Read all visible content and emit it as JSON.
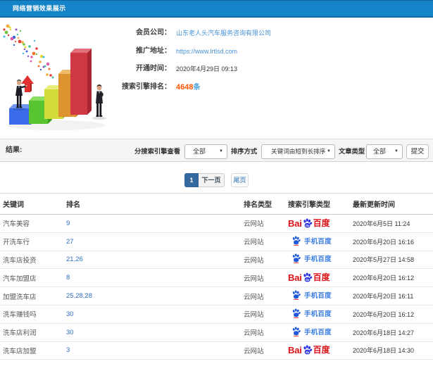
{
  "titlebar": {
    "title": "网络营销效果展示"
  },
  "info": {
    "rows": [
      {
        "label": "会员公司：",
        "value": "山东老人头汽车服务咨询有限公司",
        "style": "link"
      },
      {
        "label": "推广地址：",
        "value": "https://www.lrtlsd.com",
        "style": "link"
      },
      {
        "label": "开通时间：",
        "value": "2020年4月29日 09:13",
        "style": "text"
      },
      {
        "label": "搜索引擎排名：",
        "value": "4648",
        "suffix": "条",
        "style": "rank"
      }
    ]
  },
  "filter": {
    "result_label": "结果:",
    "engine_label": "分搜索引擎查看",
    "engine_value": "全部",
    "sort_label": "排序方式",
    "sort_value": "关键词由短到长排序",
    "type_label": "文章类型",
    "type_value": "全部",
    "submit_label": "提交"
  },
  "pagination": {
    "current": "1",
    "next": "下一页",
    "last": "尾页"
  },
  "table": {
    "headers": [
      "关键词",
      "排名",
      "排名类型",
      "搜索引擎类型",
      "最新更新时间"
    ],
    "engine_labels": {
      "baidu_bai": "Bai",
      "baidu_du": "du",
      "baidu_cn": "百度",
      "shouji": "手机百度"
    },
    "rows": [
      {
        "keyword": "汽车美容",
        "rank": "9",
        "rank_type": "云网站",
        "engine": "baidu",
        "updated": "2020年6月5日 11:24"
      },
      {
        "keyword": "开洗车行",
        "rank": "27",
        "rank_type": "云网站",
        "engine": "shouji",
        "updated": "2020年6月20日 16:16"
      },
      {
        "keyword": "洗车店投资",
        "rank": "21,26",
        "rank_type": "云网站",
        "engine": "shouji",
        "updated": "2020年5月27日 14:58"
      },
      {
        "keyword": "汽车加盟店",
        "rank": "8",
        "rank_type": "云网站",
        "engine": "baidu",
        "updated": "2020年6月20日 16:12"
      },
      {
        "keyword": "加盟洗车店",
        "rank": "25,28,28",
        "rank_type": "云网站",
        "engine": "shouji",
        "updated": "2020年6月20日 16:11"
      },
      {
        "keyword": "洗车赚钱吗",
        "rank": "30",
        "rank_type": "云网站",
        "engine": "shouji",
        "updated": "2020年6月20日 16:12"
      },
      {
        "keyword": "洗车店利润",
        "rank": "30",
        "rank_type": "云网站",
        "engine": "shouji",
        "updated": "2020年6月18日 14:27"
      },
      {
        "keyword": "洗车店加盟",
        "rank": "3",
        "rank_type": "云网站",
        "engine": "baidu",
        "updated": "2020年6月18日 14:30"
      }
    ]
  },
  "colors": {
    "titlebar_blue": "#1583c7",
    "link_blue": "#4693d6",
    "rank_orange": "#ff5400",
    "active_page_blue": "#34699d",
    "baidu_red": "#dd0f17",
    "baidu_blue": "#2932e1",
    "mobile_baidu_blue": "#3b7de2"
  }
}
